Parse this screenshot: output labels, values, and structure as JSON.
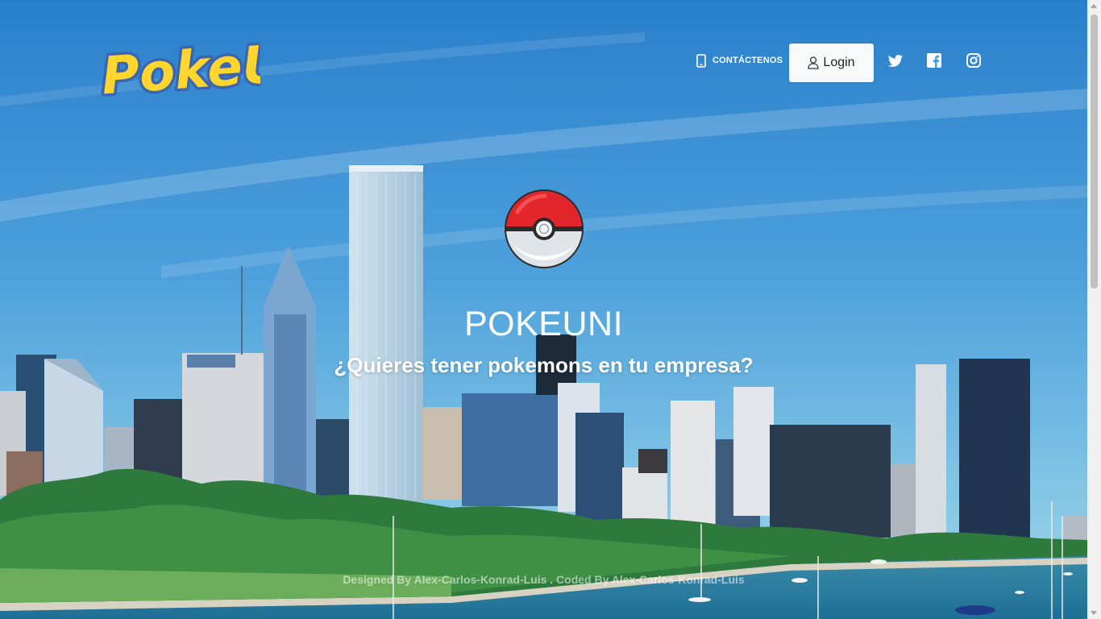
{
  "logo": {
    "text": "PokeUni"
  },
  "nav": {
    "contact_label": "CONTÁCTENOS",
    "login_label": "Login",
    "social": [
      "twitter-icon",
      "facebook-icon",
      "instagram-icon"
    ]
  },
  "hero": {
    "title": "POKEUNI",
    "tagline": "¿Quieres tener pokemons en tu empresa?"
  },
  "footer": {
    "credit": "Designed By Alex-Carlos-Konrad-Luis . Coded By Alex-Carlos-Konrad-Luis"
  },
  "colors": {
    "sky_top": "#2a80cc",
    "sky_bottom": "#8fcbe8",
    "logo_yellow": "#ffd52e",
    "logo_blue": "#3a65b0",
    "pokeball_red": "#e3262b",
    "button_bg": "#f8f9fa"
  }
}
